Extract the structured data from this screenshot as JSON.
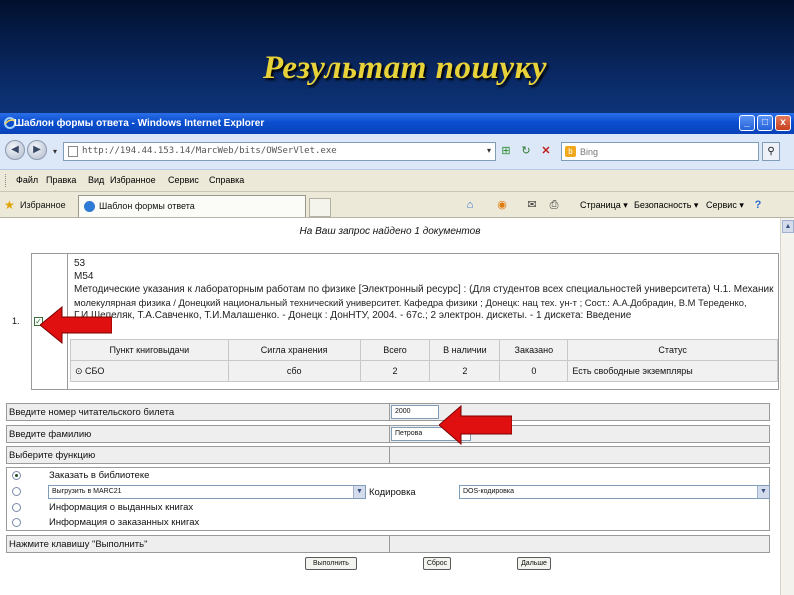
{
  "slide": {
    "title": "Результат пошуку"
  },
  "window": {
    "title": "Шаблон формы ответа - Windows Internet Explorer",
    "url": "http://194.44.153.14/MarcWeb/bits/OWSerVlet.exe",
    "search_placeholder": "Bing",
    "minimize": "_",
    "maximize": "□",
    "close": "x"
  },
  "menu": [
    "Файл",
    "Правка",
    "Вид",
    "Избранное",
    "Сервис",
    "Справка"
  ],
  "favorites": {
    "label": "Избранное",
    "tab_title": "Шаблон формы ответа",
    "commands": [
      "Страница ▾",
      "Безопасность ▾",
      "Сервис ▾"
    ]
  },
  "results": {
    "found_text": "На Ваш запрос найдено 1 документов",
    "record_number": "1.",
    "record_lines": [
      "53",
      "М54",
      "  Методические указания к лабораторным работам по физике [Электронный ресурс] : (Для студентов всех специальностей университета) Ч.1. Механика и",
      "молекулярная физика / Донецкий национальный технический университет. Кафедра физики ; Донецк: нац тех. ун-т ; Сост.: А.А.Добрадин, В.М Тереденко,",
      "Г.И.Шепеляк, Т.А.Савченко, Т.И.Малашенко. - Донецк : ДонНТУ, 2004. - 67с.; 2 электрон. дискеты. - 1 дискета: Введение"
    ],
    "holdings_headers": [
      "Пункт книговыдачи",
      "Сигла хранения",
      "Всего",
      "В наличии",
      "Заказано",
      "Статус"
    ],
    "holdings_row": [
      "⊙ СБО",
      "сбо",
      "2",
      "2",
      "0",
      "Есть свободные экземпляры"
    ]
  },
  "form": {
    "reader_card_label": "Введите номер читательского билета",
    "reader_card_value": "2000",
    "surname_label": "Введите фамилию",
    "surname_value": "Петрова",
    "function_label": "Выберите функцию",
    "options": [
      "Заказать в библиотеке",
      "Информация о выданных книгах",
      "Информация о заказанных книгах"
    ],
    "export_select": "Выгрузить в MARC21",
    "encoding_label": "Кодировка",
    "encoding_select": "DOS-кодировка",
    "press_label": "Нажмите клавишу \"Выполнить\"",
    "buttons": [
      "Выполнить",
      "Сброс",
      "Дальше"
    ]
  },
  "colors": {
    "title_yellow": "#e8d23a",
    "slide_bg": "#0a2a66",
    "arrow_red": "#e01010"
  }
}
